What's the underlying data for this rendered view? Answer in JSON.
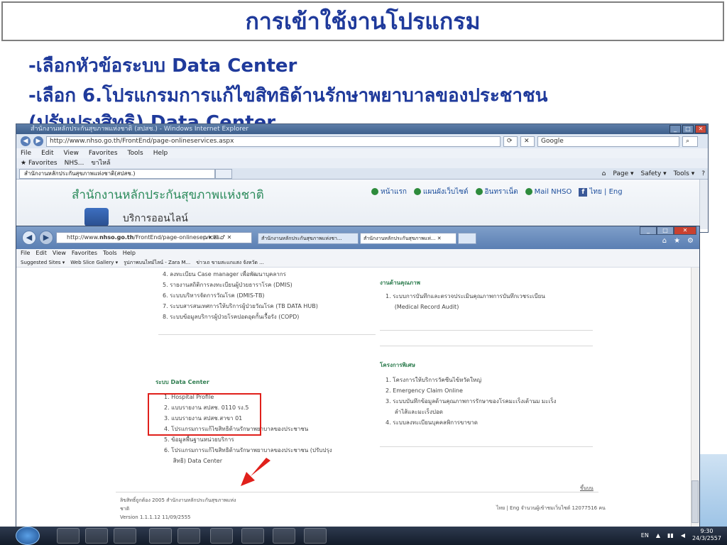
{
  "slide": {
    "title": "การเข้าใช้งานโปรแกรม",
    "bullet1": "-เลือกหัวข้อระบบ Data Center",
    "bullet2": "-เลือก 6.โปรแกรมการแก้ไขสิทธิด้านรักษาพยาบาลของประชาชน",
    "bullet3": "(ปรับปรุงสิทธิ) Data Center"
  },
  "ie1": {
    "caption": "สำนักงานหลักประกันสุขภาพแห่งชาติ (สปสช.) - Windows Internet Explorer",
    "address": "http://www.nhso.go.th/FrontEnd/page-onlineservices.aspx",
    "search_placeholder": "Google",
    "menu": [
      "File",
      "Edit",
      "View",
      "Favorites",
      "Tools",
      "Help"
    ],
    "favorites": [
      "Favorites",
      "NHS...",
      "ขาไหล้"
    ],
    "tab": "สำนักงานหลักประกันสุขภาพแห่งชาติ(สปสช.)",
    "cmd": [
      "Page ▾",
      "Safety ▾",
      "Tools ▾"
    ],
    "org_name": "สำนักงานหลักประกันสุขภาพแห่งชาติ",
    "links": [
      "หน้าแรก",
      "แผนผังเว็บไซต์",
      "อินทราเน็ต",
      "Mail NHSO",
      "ไทย | Eng"
    ],
    "online_label": "บริการออนไลน์"
  },
  "ie2": {
    "address_prefix": "http://www.",
    "address_bold": "nhso.go.th",
    "address_suffix": "/FrontEnd/page-onlineservices.",
    "address_buttons": "ρ ▾ ☒ ♂ ✕",
    "tab1": "สำนักงานหลักประกันสุขภาพแห่งชา...",
    "tab2": "สำนักงานหลักประกันสุขภาพแห่...  ✕",
    "menu": [
      "File",
      "Edit",
      "View",
      "Favorites",
      "Tools",
      "Help"
    ],
    "favorites": [
      "Suggested Sites ▾",
      "Web Slice Gallery ▾",
      "รูปภาพบนไทม์ไลน์ - Zara M...",
      "ข่าวเถ ขามสะแกแสง จังหวัด ..."
    ],
    "left_top_items": [
      "4.  ลงทะเบียน Case manager เพื่อพัฒนาบุคลากร",
      "5.  รายงานสถิติการลงทะเบียนผู้ป่วยธาราโรค (DMIS)",
      "6.  ระบบบริหารจัดการวัณโรค (DMIS-TB)",
      "7.  ระบบสารสนเทศการให้บริการผู้ป่วยวัณโรค (TB DATA HUB)",
      "8.  ระบบข้อมูลบริการผู้ป่วยโรคปอดอุดกั้นเรื้อรัง (COPD)"
    ],
    "quality_head": "งานด้านคุณภาพ",
    "quality_items": [
      "1.  ระบบการบันทึกและตรวจประเมินคุณภาพการบันทึกเวชระเบียน",
      "     (Medical Record Audit)"
    ],
    "special_head": "โครงการพิเศษ",
    "special_items": [
      "1.  โครงการให้บริการวัคซีนไข้หวัดใหญ่",
      "2.  Emergency Claim Online",
      "3.  ระบบบันทึกข้อมูลด้านคุณภาพการรักษาของโรคมะเร็งเต้านม มะเร็ง",
      "     ลำไส้และมะเร็งปอด",
      "4.  ระบบลงทะเบียนบุคคลพิการขาขาด"
    ],
    "dc_head": "ระบบ Data Center",
    "dc_items": [
      "1.  Hospital Profile",
      "2.  แบบรายงาน สปสช. 0110 รง.5",
      "3.  แบบรายงาน สปสช.สาขา 01",
      "4.  โปรแกรมการแก้ไขสิทธิด้านรักษาพยาบาลของประชาชน",
      "5.  ข้อมูลพื้นฐานหน่วยบริการ",
      "6.  โปรแกรมการแก้ไขสิทธิด้านรักษาพยาบาลของประชาชน (ปรับปรุง",
      "     สิทธิ) Data Center"
    ],
    "back_to_top": "ขึ้นบน",
    "footer_lines": [
      "ลิขสิทธิ์ถูกต้อง 2005 สำนักงานหลักประกันสุขภาพแห่ง",
      "ชาติ",
      "Version 1.1.1.12  11/09/2555"
    ],
    "footer_right": "ไทย | Eng จำนวนผู้เข้าชมเว็บไซต์ 12077516   คน"
  },
  "taskbar": {
    "lang": "EN",
    "time": "9:30",
    "date": "24/3/2557"
  },
  "colors": {
    "title": "#1f3a9b",
    "highlight": "#e0201b",
    "section_head": "#2e7d4f"
  }
}
